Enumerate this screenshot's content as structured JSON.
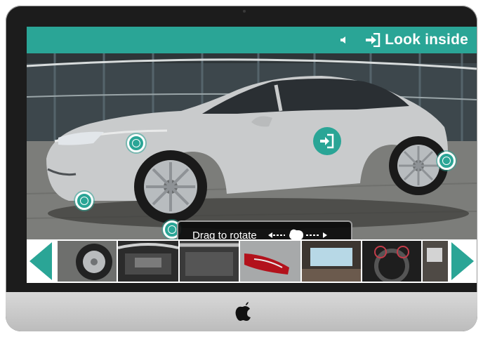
{
  "topbar": {
    "look_inside_label": "Look inside",
    "sound_icon": "speaker-icon",
    "enter_icon": "sign-in-icon"
  },
  "viewer": {
    "drag_label": "Drag to rotate",
    "hotspot_icon": "hotspot-ring-icon",
    "enter_hotspot_icon": "sign-in-icon"
  },
  "thumbnails": [
    {
      "name": "thumb-wheel-tire"
    },
    {
      "name": "thumb-engine-bay"
    },
    {
      "name": "thumb-trunk"
    },
    {
      "name": "thumb-tail-light"
    },
    {
      "name": "thumb-sunroof"
    },
    {
      "name": "thumb-dashboard"
    },
    {
      "name": "thumb-door-interior"
    }
  ],
  "colors": {
    "accent": "#2aa596",
    "bezel": "#1c1c1c",
    "chin": "#cfcfcf"
  }
}
